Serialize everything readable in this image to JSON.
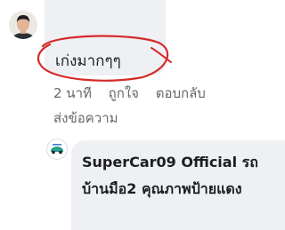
{
  "comment": {
    "text": "เก่งมากๆๆ",
    "time": "2 นาที",
    "like_label": "ถูกใจ",
    "reply_label": "ตอบกลับ",
    "send_message_label": "ส่งข้อความ"
  },
  "reply": {
    "author": "SuperCar09 Official",
    "text": " รถบ้านมือ2 คุณภาพป้ายแดง"
  },
  "colors": {
    "bubble": "#eef0f3",
    "meta_text": "#65676b",
    "annotation": "#d62a2a"
  }
}
